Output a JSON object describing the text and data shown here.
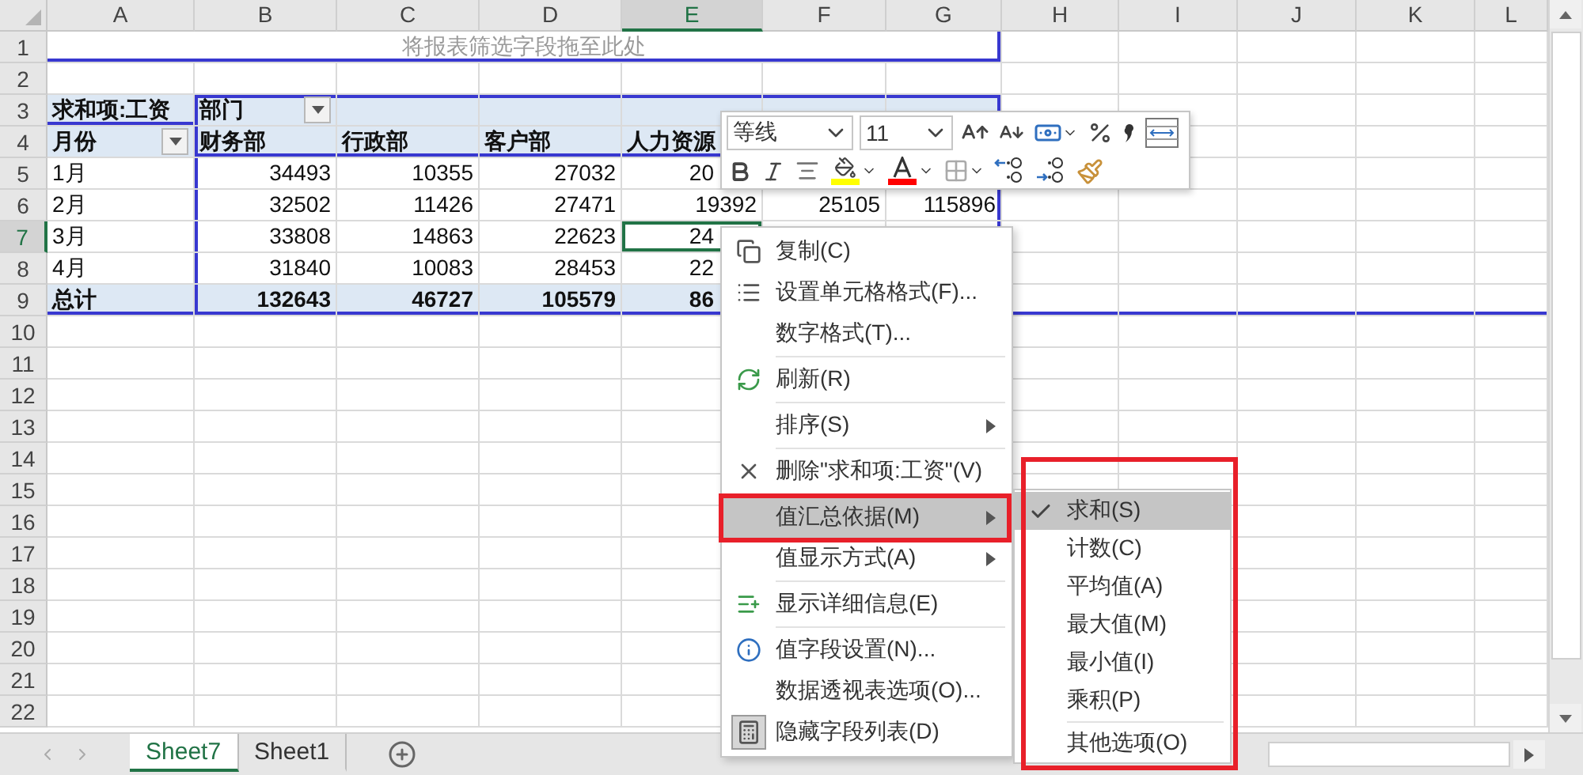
{
  "columns": [
    {
      "label": "A",
      "selected": false
    },
    {
      "label": "B",
      "selected": false
    },
    {
      "label": "C",
      "selected": false
    },
    {
      "label": "D",
      "selected": false
    },
    {
      "label": "E",
      "selected": true
    },
    {
      "label": "F",
      "selected": false
    },
    {
      "label": "G",
      "selected": false
    },
    {
      "label": "H",
      "selected": false
    },
    {
      "label": "I",
      "selected": false
    },
    {
      "label": "J",
      "selected": false
    },
    {
      "label": "K",
      "selected": false
    },
    {
      "label": "L",
      "selected": false
    }
  ],
  "rows": [
    {
      "number": "1",
      "kind": "filter",
      "selected": false,
      "cells": [
        "将报表筛选字段拖至此处"
      ]
    },
    {
      "number": "2",
      "kind": "blank",
      "selected": false,
      "cells": []
    },
    {
      "number": "3",
      "kind": "field",
      "selected": false,
      "cells": [
        "求和项:工资",
        "部门"
      ]
    },
    {
      "number": "4",
      "kind": "header",
      "selected": false,
      "cells": [
        "月份",
        "财务部",
        "行政部",
        "客户部",
        "人力资源"
      ]
    },
    {
      "number": "5",
      "kind": "data",
      "selected": false,
      "cells": [
        "1月",
        "34493",
        "10355",
        "27032",
        "20"
      ]
    },
    {
      "number": "6",
      "kind": "data",
      "selected": false,
      "cells": [
        "2月",
        "32502",
        "11426",
        "27471",
        "19392",
        "25105",
        "115896"
      ]
    },
    {
      "number": "7",
      "kind": "data",
      "selected": true,
      "cells": [
        "3月",
        "33808",
        "14863",
        "22623",
        "24"
      ]
    },
    {
      "number": "8",
      "kind": "data",
      "selected": false,
      "cells": [
        "4月",
        "31840",
        "10083",
        "28453",
        "22"
      ]
    },
    {
      "number": "9",
      "kind": "total",
      "selected": false,
      "cells": [
        "总计",
        "132643",
        "46727",
        "105579",
        "86"
      ]
    },
    {
      "number": "10",
      "kind": "blank",
      "selected": false,
      "cells": []
    },
    {
      "number": "11",
      "kind": "blank",
      "selected": false,
      "cells": []
    },
    {
      "number": "12",
      "kind": "blank",
      "selected": false,
      "cells": []
    },
    {
      "number": "13",
      "kind": "blank",
      "selected": false,
      "cells": []
    },
    {
      "number": "14",
      "kind": "blank",
      "selected": false,
      "cells": []
    },
    {
      "number": "15",
      "kind": "blank",
      "selected": false,
      "cells": []
    },
    {
      "number": "16",
      "kind": "blank",
      "selected": false,
      "cells": []
    },
    {
      "number": "17",
      "kind": "blank",
      "selected": false,
      "cells": []
    },
    {
      "number": "18",
      "kind": "blank",
      "selected": false,
      "cells": []
    },
    {
      "number": "19",
      "kind": "blank",
      "selected": false,
      "cells": []
    },
    {
      "number": "20",
      "kind": "blank",
      "selected": false,
      "cells": []
    },
    {
      "number": "21",
      "kind": "blank",
      "selected": false,
      "cells": []
    },
    {
      "number": "22",
      "kind": "blank",
      "selected": false,
      "cells": []
    }
  ],
  "mini_toolbar": {
    "font_name": "等线",
    "font_size": "11"
  },
  "context_menu": [
    {
      "kind": "command",
      "label": "复制(C)",
      "submenu": false,
      "selected": false,
      "checked": false,
      "annotated": false
    },
    {
      "kind": "command",
      "label": "设置单元格格式(F)...",
      "submenu": false,
      "selected": false,
      "checked": false,
      "annotated": false
    },
    {
      "kind": "command",
      "label": "数字格式(T)...",
      "submenu": false,
      "selected": false,
      "checked": false,
      "annotated": false
    },
    {
      "kind": "separator"
    },
    {
      "kind": "command",
      "label": "刷新(R)",
      "submenu": false,
      "selected": false,
      "checked": false,
      "annotated": false
    },
    {
      "kind": "separator"
    },
    {
      "kind": "command",
      "label": "排序(S)",
      "submenu": true,
      "selected": false,
      "checked": false,
      "annotated": false
    },
    {
      "kind": "separator"
    },
    {
      "kind": "command",
      "label": "删除\"求和项:工资\"(V)",
      "submenu": false,
      "selected": false,
      "checked": false,
      "annotated": false
    },
    {
      "kind": "separator"
    },
    {
      "kind": "command",
      "label": "值汇总依据(M)",
      "submenu": true,
      "selected": true,
      "checked": false,
      "annotated": true
    },
    {
      "kind": "command",
      "label": "值显示方式(A)",
      "submenu": true,
      "selected": false,
      "checked": false,
      "annotated": false
    },
    {
      "kind": "separator"
    },
    {
      "kind": "command",
      "label": "显示详细信息(E)",
      "submenu": false,
      "selected": false,
      "checked": false,
      "annotated": false
    },
    {
      "kind": "separator"
    },
    {
      "kind": "command",
      "label": "值字段设置(N)...",
      "submenu": false,
      "selected": false,
      "checked": false,
      "annotated": false
    },
    {
      "kind": "command",
      "label": "数据透视表选项(O)...",
      "submenu": false,
      "selected": false,
      "checked": false,
      "annotated": false
    },
    {
      "kind": "command",
      "label": "隐藏字段列表(D)",
      "submenu": false,
      "selected": false,
      "checked": true,
      "annotated": false
    }
  ],
  "submenu": {
    "annotated": true,
    "items": [
      {
        "kind": "command",
        "label": "求和(S)",
        "checked": true,
        "selected": true
      },
      {
        "kind": "command",
        "label": "计数(C)",
        "checked": false,
        "selected": false
      },
      {
        "kind": "command",
        "label": "平均值(A)",
        "checked": false,
        "selected": false
      },
      {
        "kind": "command",
        "label": "最大值(M)",
        "checked": false,
        "selected": false
      },
      {
        "kind": "command",
        "label": "最小值(I)",
        "checked": false,
        "selected": false
      },
      {
        "kind": "command",
        "label": "乘积(P)",
        "checked": false,
        "selected": false
      },
      {
        "kind": "separator"
      },
      {
        "kind": "command",
        "label": "其他选项(O)",
        "checked": false,
        "selected": false
      }
    ]
  },
  "sheet_tabs": [
    {
      "label": "Sheet7",
      "selected": true
    },
    {
      "label": "Sheet1",
      "selected": false
    }
  ]
}
